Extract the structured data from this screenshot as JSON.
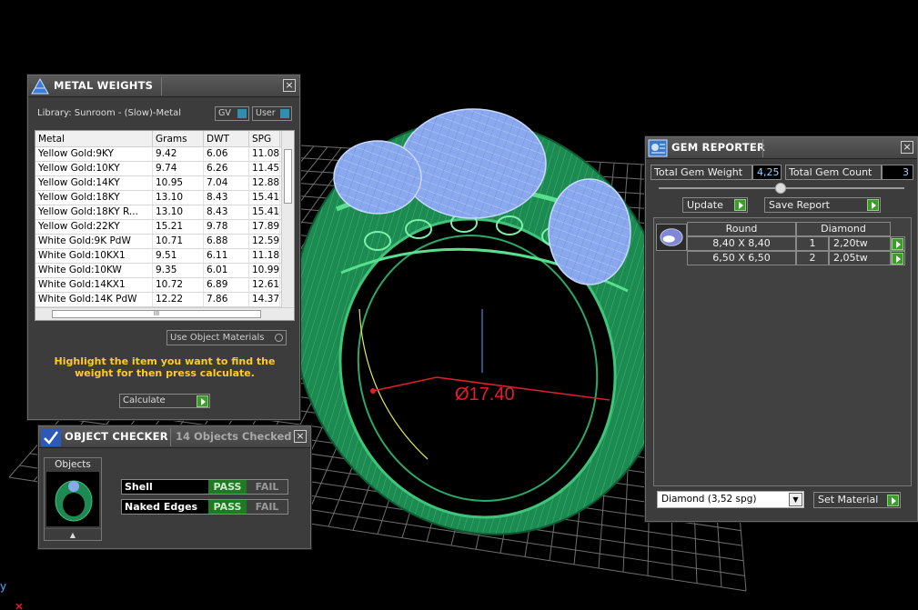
{
  "viewport": {
    "dimension_text": "Ø17.40",
    "axis_letter": "y"
  },
  "metal_weights": {
    "title": "METAL WEIGHTS",
    "library": "Library: Sunroom - (Slow)-Metal",
    "toggle_gv": "GV",
    "toggle_user": "User",
    "columns": [
      "Metal",
      "Grams",
      "DWT",
      "SPG"
    ],
    "rows": [
      [
        "Yellow Gold:9KY",
        "9.42",
        "6.06",
        "11.08"
      ],
      [
        "Yellow Gold:10KY",
        "9.74",
        "6.26",
        "11.45"
      ],
      [
        "Yellow Gold:14KY",
        "10.95",
        "7.04",
        "12.88"
      ],
      [
        "Yellow Gold:18KY",
        "13.10",
        "8.43",
        "15.41"
      ],
      [
        "Yellow Gold:18KY R...",
        "13.10",
        "8.43",
        "15.41"
      ],
      [
        "Yellow Gold:22KY",
        "15.21",
        "9.78",
        "17.89"
      ],
      [
        "White Gold:9K PdW",
        "10.71",
        "6.88",
        "12.59"
      ],
      [
        "White Gold:10KX1",
        "9.51",
        "6.11",
        "11.18"
      ],
      [
        "White Gold:10KW",
        "9.35",
        "6.01",
        "10.99"
      ],
      [
        "White Gold:14KX1",
        "10.72",
        "6.89",
        "12.61"
      ],
      [
        "White Gold:14K PdW",
        "12.22",
        "7.86",
        "14.37"
      ]
    ],
    "scroll_grip": "III",
    "use_object_materials": "Use Object Materials",
    "hint": "Highlight the item you want to find the weight for then press calculate.",
    "calculate": "Calculate"
  },
  "object_checker": {
    "title": "OBJECT CHECKER",
    "count_text": "14  Objects Checked",
    "objects_label": "Objects",
    "checks": [
      {
        "label": "Shell",
        "pass": "PASS",
        "fail": "FAIL"
      },
      {
        "label": "Naked Edges",
        "pass": "PASS",
        "fail": "FAIL"
      }
    ]
  },
  "gem_reporter": {
    "title": "GEM REPORTER",
    "total_weight_label": "Total Gem Weight",
    "total_weight_value": "4,25",
    "total_count_label": "Total Gem Count",
    "total_count_value": "3",
    "update": "Update",
    "save_report": "Save Report",
    "header_shape": "Round",
    "header_material": "Diamond",
    "gems": [
      {
        "size": "8,40 X 8,40",
        "count": "1",
        "weight": "2,20tw"
      },
      {
        "size": "6,50 X 6,50",
        "count": "2",
        "weight": "2,05tw"
      }
    ],
    "material_select": "Diamond    (3,52 spg)",
    "set_material": "Set Material"
  },
  "colors": {
    "ring_green": "#1f8f55",
    "gem_blue": "#8fb2ff",
    "grid": "#7a7a7a",
    "dimension_red": "#e0202a",
    "pass_green": "#1f7a24",
    "hint_yellow": "#ffcc22"
  }
}
